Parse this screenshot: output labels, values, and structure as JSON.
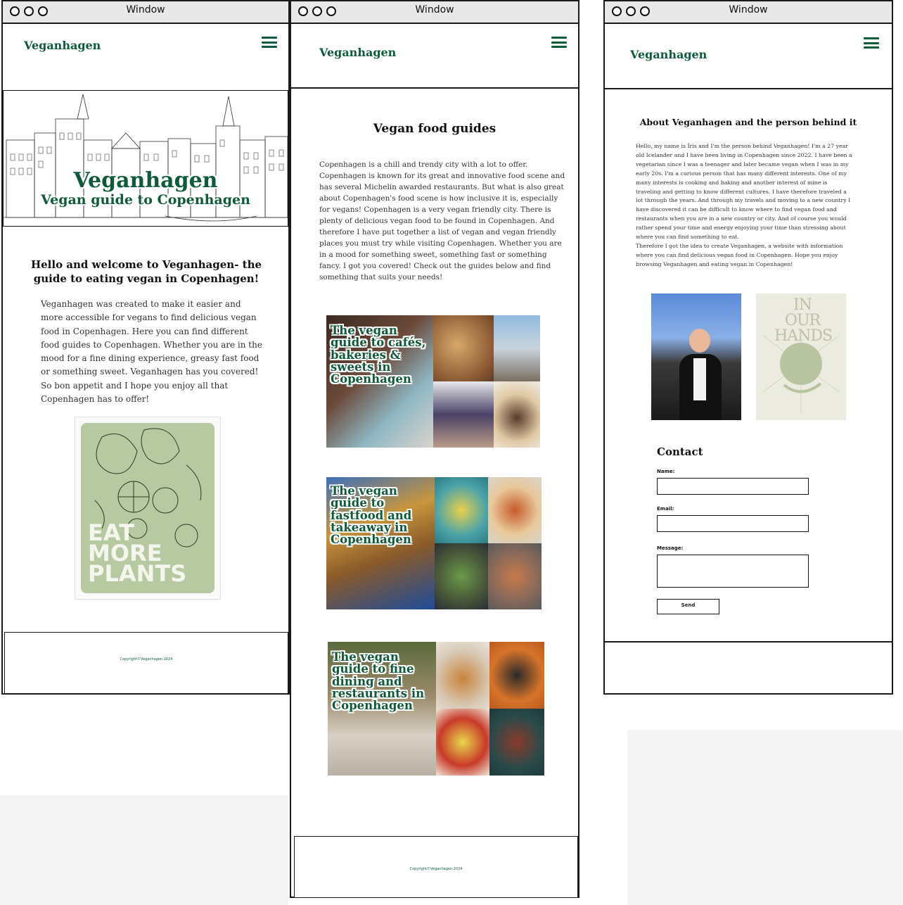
{
  "window_title": "Window",
  "brand": "Veganhagen",
  "colors": {
    "brand_green": "#0e5b3a",
    "sage": "#b7c9a0",
    "frame": "#1a1a1a"
  },
  "copyright": "Copyright©Veganhagen 2024",
  "page1": {
    "hero_title": "Veganhagen",
    "hero_subtitle": "Vegan guide to Copenhagen",
    "heading": "Hello and welcome to Veganhagen- the guide to eating vegan in Copenhagen!",
    "body": "Veganhagen was created to make it easier and more accessible for vegans to find delicious vegan food in Copenhagen. Here you can find different food guides to Copenhagen. Whether you are in the mood for a fine dining experience, greasy fast food or something sweet. Veganhagen has you covered! So bon appetit and I hope you enjoy all that Copenhagen has to offer!",
    "poster_lines": [
      "EAT",
      "MORE",
      "PLANTS"
    ]
  },
  "page2": {
    "heading": "Vegan food guides",
    "body": "Copenhagen is a chill and trendy city with a lot to offer. Copenhagen is known for its great and innovative food scene and has several Michelin awarded restaurants. But what is also great about Copenhagen's food scene is how inclusive it is, especially for vegans! Copenhagen is a very vegan friendly city. There is plenty of delicious vegan food to be found in Copenhagen. And therefore I have put together a list of vegan and vegan friendly places you must try while visiting Copenhagen. Whether you are in a mood for something sweet, something fast or something fancy. I got you covered! Check out the guides below and find something that suits your needs!",
    "guides": [
      {
        "title": "The vegan guide to cafés, bakeries & sweets in Copenhagen"
      },
      {
        "title": "The vegan guide to fastfood and takeaway in Copenhagen"
      },
      {
        "title": "The vegan guide to fine dining and restaurants in Copenhagen"
      }
    ]
  },
  "page3": {
    "heading": "About Veganhagen and the person behind it",
    "body": "Hello, my name is Íris and I'm the person behind Veganhagen! I'm a 27 year old Icelander and I have been living in Copenhagen since 2022. I have been a vegetarian since I was a teenager and later became vegan when I was in my early 20s. I'm a curious person that has many different interests. One of my many interests is cooking and baking and another interest of mine is traveling and getting to know different cultures. I have therefore traveled a lot through the years. And through my travels and moving to a new country I have discovered it can be difficult to know where to find vegan food and restaurants when you are in a new country or city. And of course you would rather spend your time and energy enjoying your time than stressing about where you can find something to eat.",
    "body2": "Therefore I got the idea to create Veganhagen, a website with information where you can find delicious vegan food in Copenhagen. Hope you enjoy browsing Veganhagen and eating vegan in Copenhagen!",
    "book_title": "IN OUR HANDS",
    "contact_heading": "Contact",
    "name_label": "Name:",
    "email_label": "Email:",
    "message_label": "Message:",
    "send_label": "Send"
  }
}
